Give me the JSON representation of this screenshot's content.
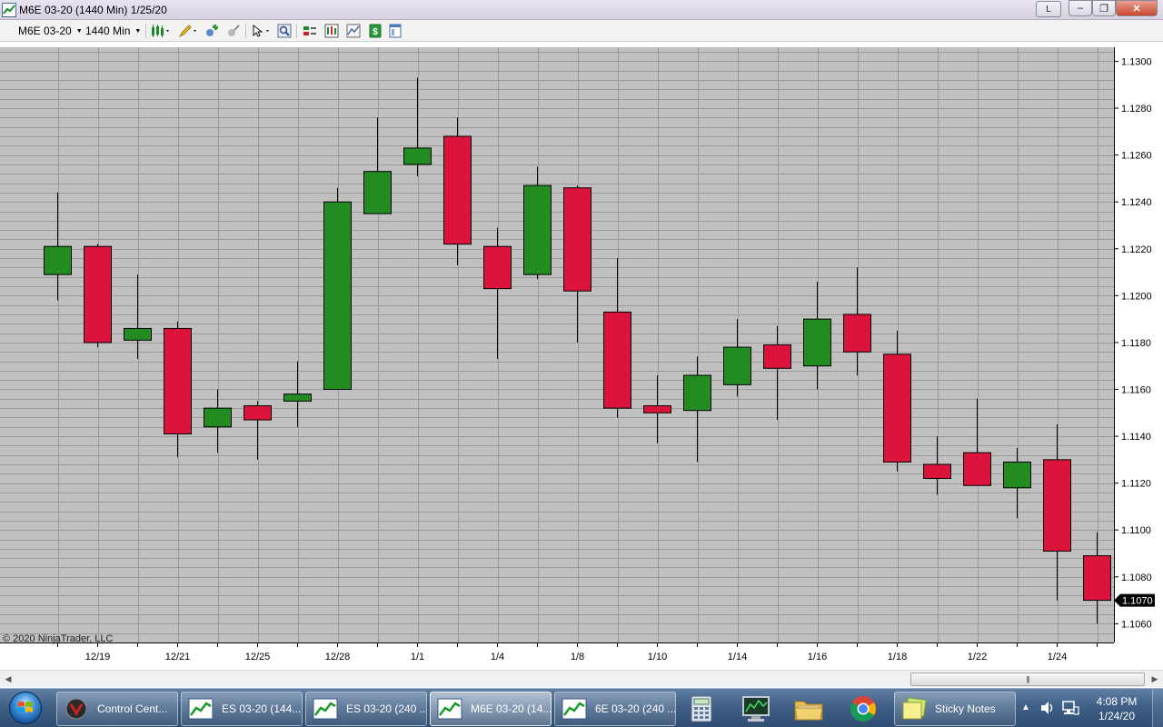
{
  "window": {
    "title": "M6E 03-20 (1440 Min)  1/25/20",
    "btn_l": "L",
    "btn_min": "–",
    "btn_max": "❐",
    "btn_close": "✕"
  },
  "toolbar": {
    "instrument": "M6E 03-20",
    "interval": "1440 Min"
  },
  "chart": {
    "copyright": "© 2020 NinjaTrader, LLC",
    "last_price_label": "1.1070"
  },
  "chart_data": {
    "type": "candlestick",
    "ylim": [
      1.1052,
      1.1306
    ],
    "y_ticks": [
      "1.1060",
      "1.1080",
      "1.1100",
      "1.1120",
      "1.1140",
      "1.1160",
      "1.1180",
      "1.1200",
      "1.1220",
      "1.1240",
      "1.1260",
      "1.1280",
      "1.1300"
    ],
    "x_tick_labels": [
      "12/19",
      "12/21",
      "12/25",
      "12/28",
      "1/1",
      "1/4",
      "1/8",
      "1/10",
      "1/14",
      "1/16",
      "1/18",
      "1/22",
      "1/24"
    ],
    "grid": true,
    "last_price": 1.107,
    "colors": {
      "up": "#228B22",
      "down": "#DC143C",
      "grid": "#9a9a9a",
      "background": "#c0c0c0"
    },
    "candles": [
      {
        "open": 1.1209,
        "high": 1.1244,
        "low": 1.1198,
        "close": 1.1221
      },
      {
        "open": 1.1221,
        "high": 1.1222,
        "low": 1.1178,
        "close": 1.118
      },
      {
        "open": 1.1181,
        "high": 1.1209,
        "low": 1.1173,
        "close": 1.1186
      },
      {
        "open": 1.1186,
        "high": 1.1189,
        "low": 1.1131,
        "close": 1.1141
      },
      {
        "open": 1.1144,
        "high": 1.116,
        "low": 1.1133,
        "close": 1.1152
      },
      {
        "open": 1.1153,
        "high": 1.1155,
        "low": 1.113,
        "close": 1.1147
      },
      {
        "open": 1.1155,
        "high": 1.1172,
        "low": 1.1144,
        "close": 1.1158
      },
      {
        "open": 1.116,
        "high": 1.1246,
        "low": 1.116,
        "close": 1.124
      },
      {
        "open": 1.1235,
        "high": 1.1276,
        "low": 1.1235,
        "close": 1.1253
      },
      {
        "open": 1.1256,
        "high": 1.1293,
        "low": 1.1251,
        "close": 1.1263
      },
      {
        "open": 1.1268,
        "high": 1.1276,
        "low": 1.1213,
        "close": 1.1222
      },
      {
        "open": 1.1221,
        "high": 1.1229,
        "low": 1.1173,
        "close": 1.1203
      },
      {
        "open": 1.1209,
        "high": 1.1255,
        "low": 1.1207,
        "close": 1.1247
      },
      {
        "open": 1.1246,
        "high": 1.1247,
        "low": 1.118,
        "close": 1.1202
      },
      {
        "open": 1.1193,
        "high": 1.1216,
        "low": 1.1148,
        "close": 1.1152
      },
      {
        "open": 1.1153,
        "high": 1.1166,
        "low": 1.1137,
        "close": 1.115
      },
      {
        "open": 1.1151,
        "high": 1.1174,
        "low": 1.1129,
        "close": 1.1166
      },
      {
        "open": 1.1162,
        "high": 1.119,
        "low": 1.1157,
        "close": 1.1178
      },
      {
        "open": 1.1179,
        "high": 1.1187,
        "low": 1.1147,
        "close": 1.1169
      },
      {
        "open": 1.117,
        "high": 1.1206,
        "low": 1.116,
        "close": 1.119
      },
      {
        "open": 1.1192,
        "high": 1.1212,
        "low": 1.1166,
        "close": 1.1176
      },
      {
        "open": 1.1175,
        "high": 1.1185,
        "low": 1.1125,
        "close": 1.1129
      },
      {
        "open": 1.1128,
        "high": 1.114,
        "low": 1.1115,
        "close": 1.1122
      },
      {
        "open": 1.1133,
        "high": 1.1156,
        "low": 1.1119,
        "close": 1.1119
      },
      {
        "open": 1.1118,
        "high": 1.1135,
        "low": 1.1105,
        "close": 1.1129
      },
      {
        "open": 1.113,
        "high": 1.1145,
        "low": 1.107,
        "close": 1.1091
      },
      {
        "open": 1.1089,
        "high": 1.1099,
        "low": 1.106,
        "close": 1.107
      }
    ]
  },
  "taskbar": {
    "buttons": [
      {
        "label": "Control Cent..."
      },
      {
        "label": "ES 03-20 (144..."
      },
      {
        "label": "ES 03-20 (240 ..."
      },
      {
        "label": "M6E 03-20 (14..."
      },
      {
        "label": "6E 03-20 (240 ..."
      }
    ],
    "sticky_notes": "Sticky Notes",
    "tray_arrow": "▲",
    "clock_time": "4:08 PM",
    "clock_date": "1/24/20"
  }
}
